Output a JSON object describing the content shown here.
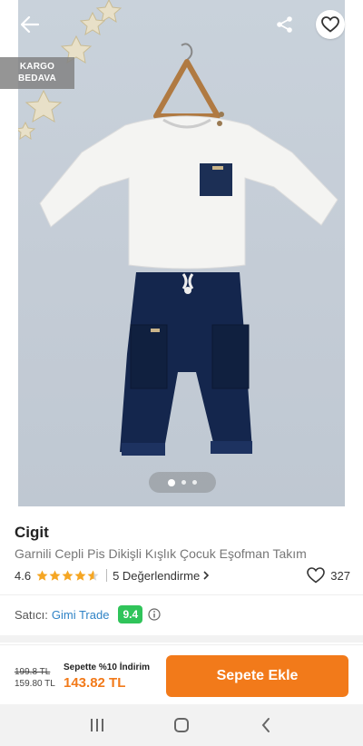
{
  "header": {
    "back_icon": "arrow-left-icon",
    "share_icon": "share-icon",
    "favorite_icon": "heart-outline-icon"
  },
  "badge": {
    "line1": "KARGO",
    "line2": "BEDAVA"
  },
  "gallery": {
    "current_index": 1,
    "total": 3
  },
  "product": {
    "brand": "Cigit",
    "name": "Garnili Cepli Pis Dikişli Kışlık Çocuk Eşofman Takım",
    "rating": "4.6",
    "rating_value": 4.6,
    "reviews": "5 Değerlendirme",
    "favorites": "327"
  },
  "seller": {
    "label": "Satıcı:",
    "name": "Gimi Trade",
    "score": "9.4"
  },
  "pricing": {
    "old_price": "199.8 TL",
    "mid_price": "159.80 TL",
    "basket_note": "Sepette %10 İndirim",
    "final_price": "143.82 TL",
    "add_to_cart": "Sepete Ekle"
  },
  "colors": {
    "accent": "#f27a1a",
    "seller_score": "#30c45a",
    "seller_link": "#2f83c6",
    "star": "#f5a623"
  },
  "navbar": {
    "recents_icon": "recents-icon",
    "home_icon": "home-icon",
    "back_icon": "chevron-left-icon"
  }
}
